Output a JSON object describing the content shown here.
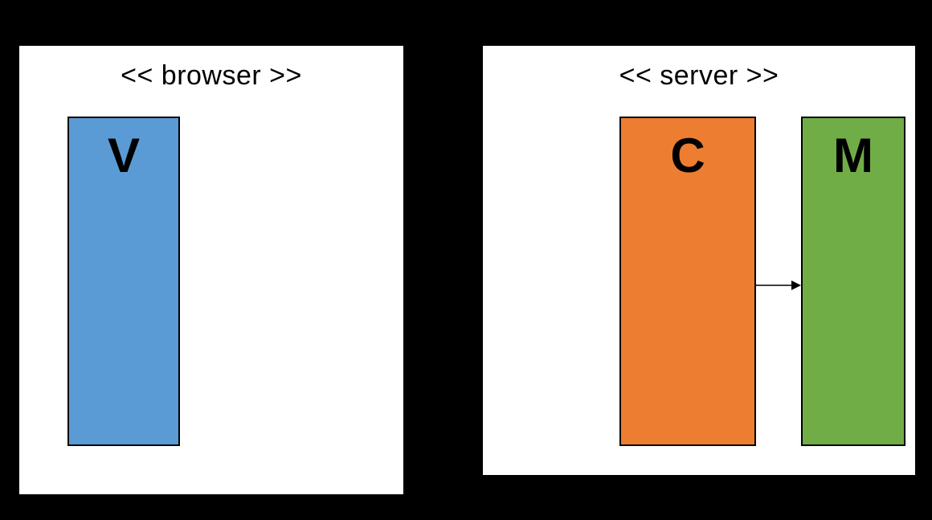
{
  "diagram": {
    "panels": {
      "browser": {
        "title": "<< browser >>",
        "boxes": {
          "view": {
            "label": "V",
            "color": "#5b9bd5"
          }
        }
      },
      "server": {
        "title": "<< server >>",
        "boxes": {
          "controller": {
            "label": "C",
            "color": "#ed7d31"
          },
          "model": {
            "label": "M",
            "color": "#70ad47"
          }
        },
        "arrows": [
          {
            "from": "controller",
            "to": "model"
          }
        ]
      }
    }
  }
}
